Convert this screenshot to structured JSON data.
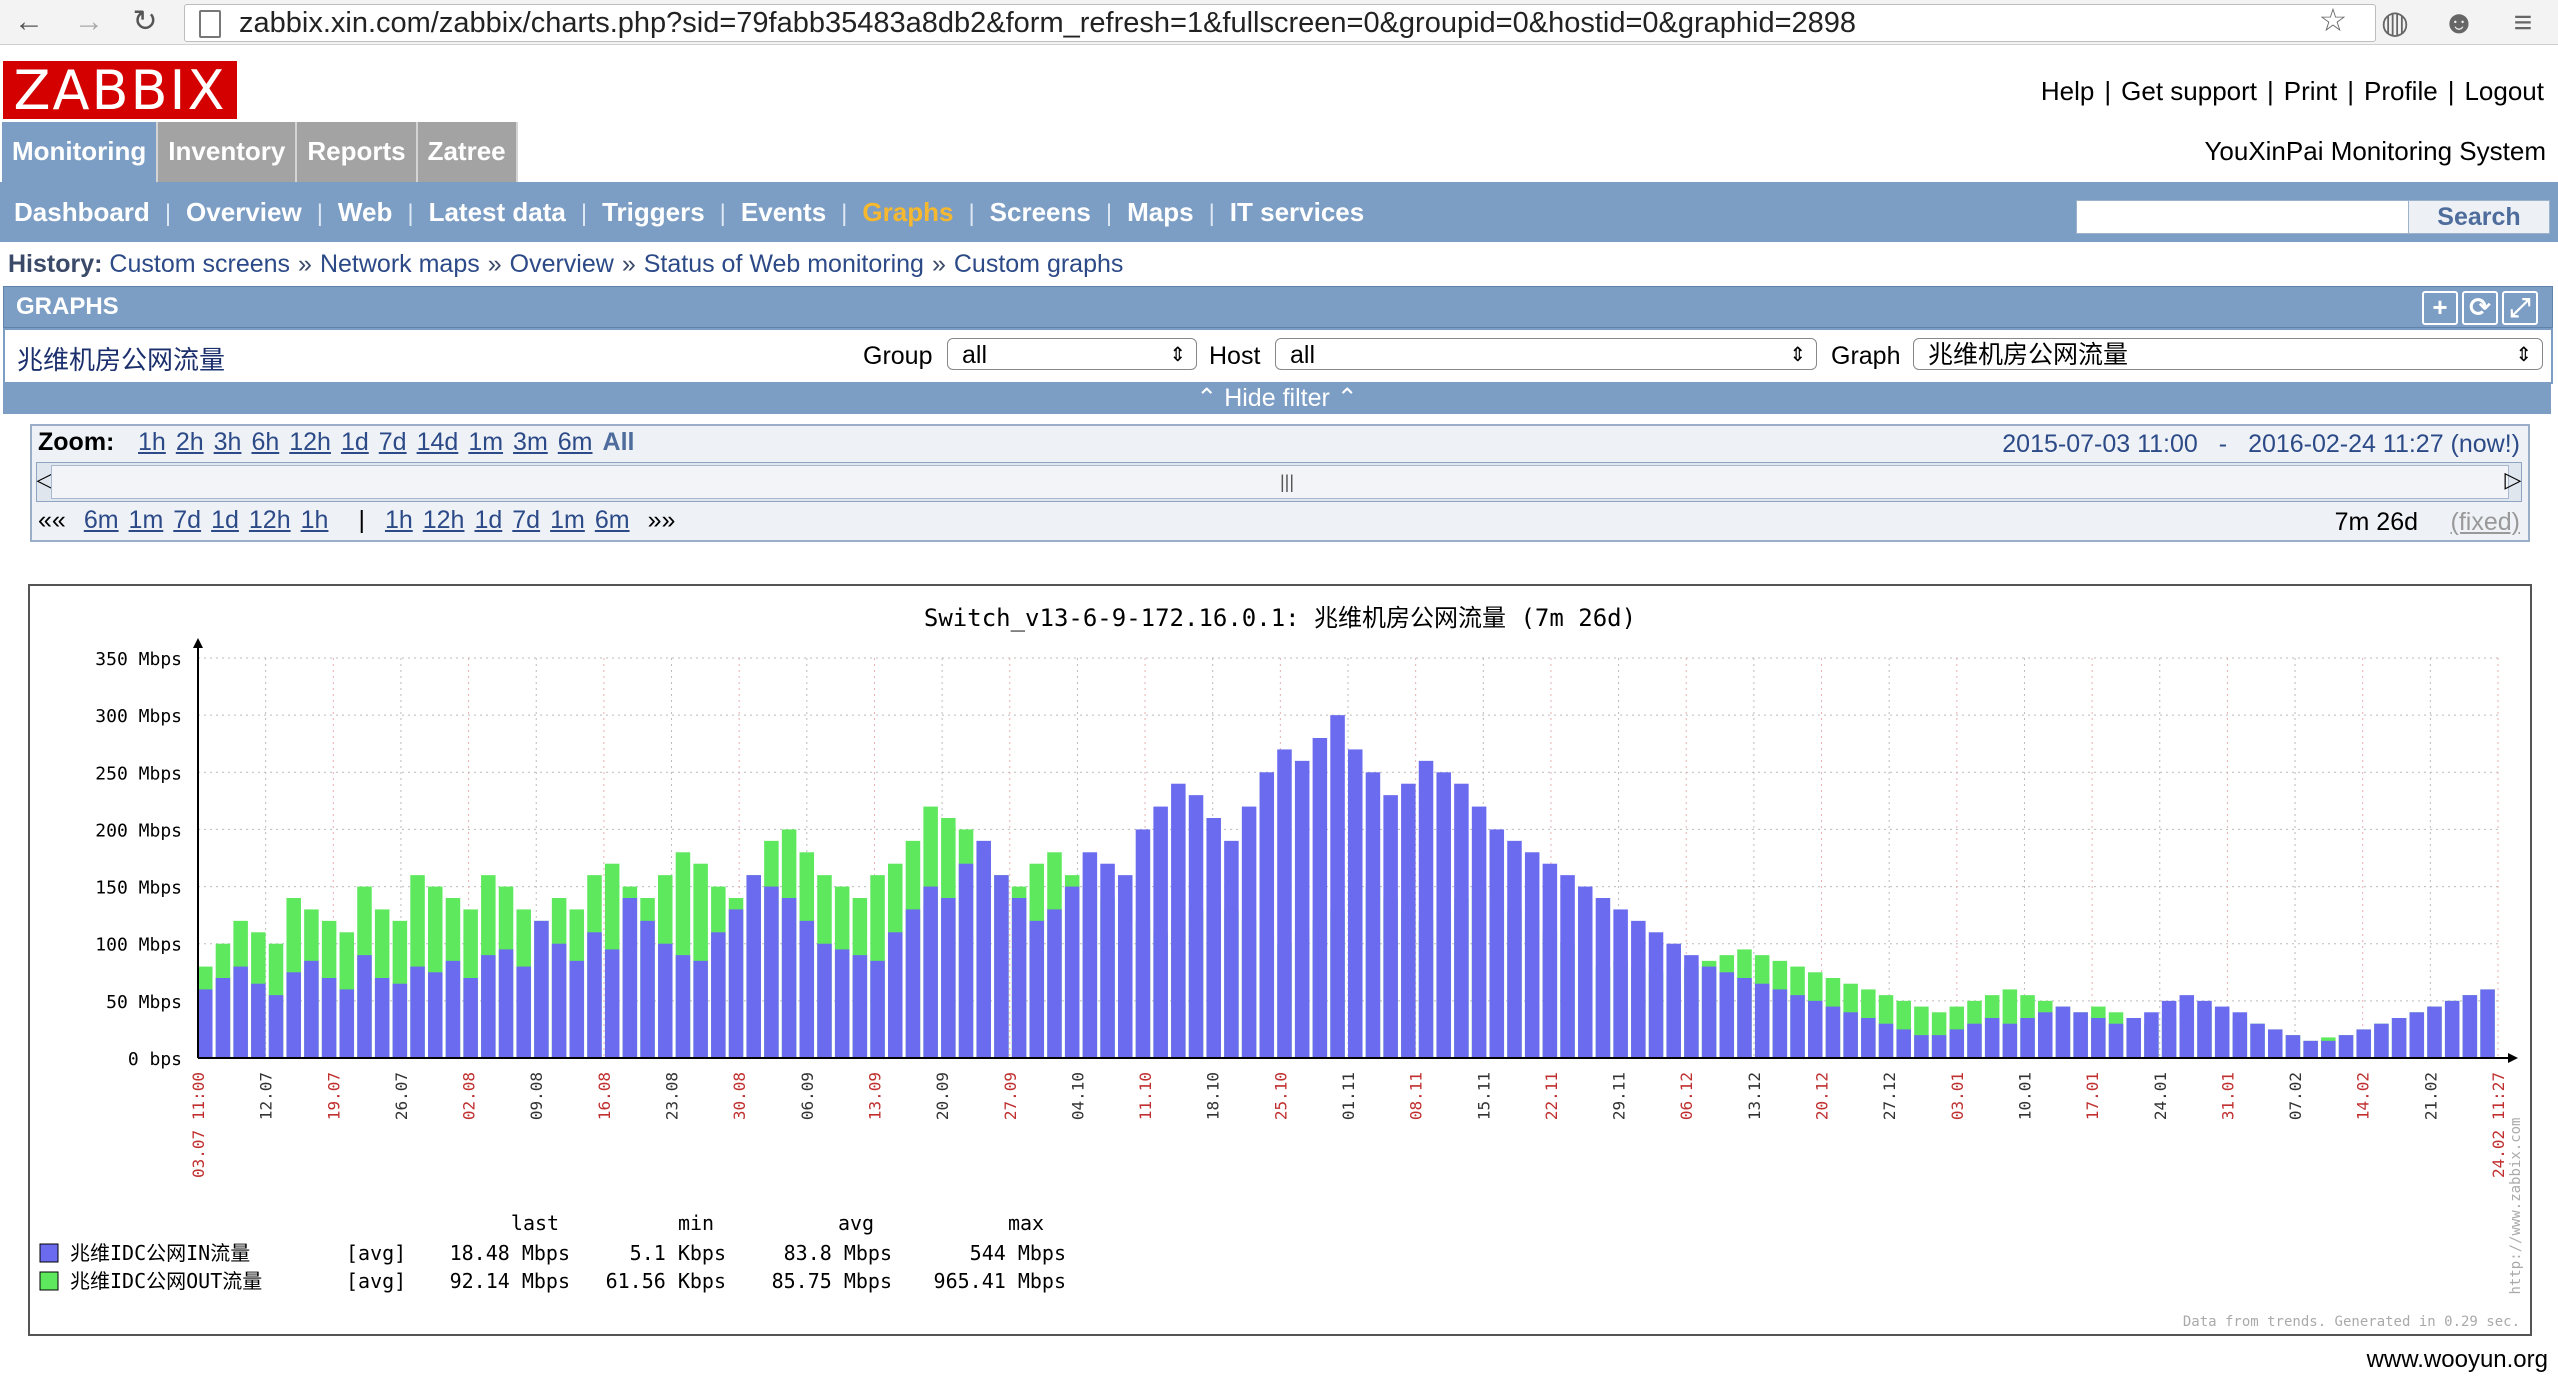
{
  "browser": {
    "url": "zabbix.xin.com/zabbix/charts.php?sid=79fabb35483a8db2&form_refresh=1&fullscreen=0&groupid=0&hostid=0&graphid=2898"
  },
  "header": {
    "logo_text": "ZABBIX",
    "top_links": [
      "Help",
      "Get support",
      "Print",
      "Profile",
      "Logout"
    ],
    "system_name": "YouXinPai Monitoring System"
  },
  "main_nav": {
    "tabs": [
      {
        "label": "Monitoring",
        "active": true
      },
      {
        "label": "Inventory",
        "active": false
      },
      {
        "label": "Reports",
        "active": false
      },
      {
        "label": "Zatree",
        "active": false
      }
    ]
  },
  "sub_nav": {
    "items": [
      {
        "label": "Dashboard",
        "active": false
      },
      {
        "label": "Overview",
        "active": false
      },
      {
        "label": "Web",
        "active": false
      },
      {
        "label": "Latest data",
        "active": false
      },
      {
        "label": "Triggers",
        "active": false
      },
      {
        "label": "Events",
        "active": false
      },
      {
        "label": "Graphs",
        "active": true
      },
      {
        "label": "Screens",
        "active": false
      },
      {
        "label": "Maps",
        "active": false
      },
      {
        "label": "IT services",
        "active": false
      }
    ],
    "search_button": "Search",
    "search_value": ""
  },
  "history": {
    "label": "History:",
    "items": [
      "Custom screens",
      "Network maps",
      "Overview",
      "Status of Web monitoring",
      "Custom graphs"
    ],
    "separator": "»"
  },
  "graphs_panel": {
    "title": "GRAPHS",
    "graph_name": "兆维机房公网流量",
    "filters": {
      "group_label": "Group",
      "group_value": "all",
      "host_label": "Host",
      "host_value": "all",
      "graph_label": "Graph",
      "graph_value": "兆维机房公网流量"
    },
    "hide_filter": "Hide filter"
  },
  "zoom": {
    "label": "Zoom:",
    "options": [
      "1h",
      "2h",
      "3h",
      "6h",
      "12h",
      "1d",
      "7d",
      "14d",
      "1m",
      "3m",
      "6m",
      "All"
    ],
    "selected": "All",
    "period_start": "2015-07-03 11:00",
    "period_sep": "-",
    "period_end": "2016-02-24 11:27 (now!)",
    "back_arrows": "««",
    "back_options": [
      "6m",
      "1m",
      "7d",
      "1d",
      "12h",
      "1h"
    ],
    "forward_options": [
      "1h",
      "12h",
      "1d",
      "7d",
      "1m",
      "6m"
    ],
    "forward_arrows": "»»",
    "divider": "|",
    "duration": "7m 26d",
    "fixed": "(fixed)"
  },
  "chart_data": {
    "type": "area",
    "title": "Switch_v13-6-9-172.16.0.1: 兆维机房公网流量 (7m 26d)",
    "y_unit": "Mbps",
    "y_ticks": [
      "0 bps",
      "50 Mbps",
      "100 Mbps",
      "150 Mbps",
      "200 Mbps",
      "250 Mbps",
      "300 Mbps",
      "350 Mbps"
    ],
    "ylim": [
      0,
      350
    ],
    "x_ticks": [
      {
        "label": "03.07 11:00",
        "red": true
      },
      {
        "label": "12.07",
        "red": false
      },
      {
        "label": "19.07",
        "red": true
      },
      {
        "label": "26.07",
        "red": false
      },
      {
        "label": "02.08",
        "red": true
      },
      {
        "label": "09.08",
        "red": false
      },
      {
        "label": "16.08",
        "red": true
      },
      {
        "label": "23.08",
        "red": false
      },
      {
        "label": "30.08",
        "red": true
      },
      {
        "label": "06.09",
        "red": false
      },
      {
        "label": "13.09",
        "red": true
      },
      {
        "label": "20.09",
        "red": false
      },
      {
        "label": "27.09",
        "red": true
      },
      {
        "label": "04.10",
        "red": false
      },
      {
        "label": "11.10",
        "red": true
      },
      {
        "label": "18.10",
        "red": false
      },
      {
        "label": "25.10",
        "red": true
      },
      {
        "label": "01.11",
        "red": false
      },
      {
        "label": "08.11",
        "red": true
      },
      {
        "label": "15.11",
        "red": false
      },
      {
        "label": "22.11",
        "red": true
      },
      {
        "label": "29.11",
        "red": false
      },
      {
        "label": "06.12",
        "red": true
      },
      {
        "label": "13.12",
        "red": false
      },
      {
        "label": "20.12",
        "red": true
      },
      {
        "label": "27.12",
        "red": false
      },
      {
        "label": "03.01",
        "red": true
      },
      {
        "label": "10.01",
        "red": false
      },
      {
        "label": "17.01",
        "red": true
      },
      {
        "label": "24.01",
        "red": false
      },
      {
        "label": "31.01",
        "red": true
      },
      {
        "label": "07.02",
        "red": false
      },
      {
        "label": "14.02",
        "red": true
      },
      {
        "label": "21.02",
        "red": false
      },
      {
        "label": "24.02 11:27",
        "red": true
      }
    ],
    "series_colors": {
      "in": "#6b6bf0",
      "out": "#5ee85e"
    },
    "series": [
      {
        "name": "兆维IDC公网IN流量",
        "values": [
          60,
          70,
          80,
          65,
          55,
          75,
          85,
          70,
          60,
          90,
          70,
          65,
          80,
          75,
          85,
          70,
          90,
          95,
          80,
          120,
          100,
          85,
          110,
          95,
          140,
          120,
          100,
          90,
          85,
          110,
          130,
          160,
          150,
          140,
          120,
          100,
          95,
          90,
          85,
          110,
          130,
          150,
          140,
          170,
          190,
          160,
          140,
          120,
          130,
          150,
          180,
          170,
          160,
          200,
          220,
          240,
          230,
          210,
          190,
          220,
          250,
          270,
          260,
          280,
          300,
          270,
          250,
          230,
          240,
          260,
          250,
          240,
          220,
          200,
          190,
          180,
          170,
          160,
          150,
          140,
          130,
          120,
          110,
          100,
          90,
          80,
          75,
          70,
          65,
          60,
          55,
          50,
          45,
          40,
          35,
          30,
          25,
          20,
          20,
          25,
          30,
          35,
          30,
          35,
          40,
          45,
          40,
          35,
          30,
          35,
          40,
          50,
          55,
          50,
          45,
          40,
          30,
          25,
          20,
          15,
          15,
          20,
          25,
          30,
          35,
          40,
          45,
          50,
          55,
          60
        ]
      },
      {
        "name": "兆维IDC公网OUT流量",
        "values": [
          80,
          100,
          120,
          110,
          100,
          140,
          130,
          120,
          110,
          150,
          130,
          120,
          160,
          150,
          140,
          130,
          160,
          150,
          130,
          120,
          140,
          130,
          160,
          170,
          150,
          140,
          160,
          180,
          170,
          150,
          140,
          160,
          190,
          200,
          180,
          160,
          150,
          140,
          160,
          170,
          190,
          220,
          210,
          200,
          180,
          160,
          150,
          170,
          180,
          160,
          150,
          140,
          130,
          120,
          110,
          120,
          130,
          140,
          130,
          120,
          110,
          100,
          110,
          120,
          130,
          140,
          150,
          140,
          130,
          120,
          130,
          140,
          150,
          140,
          130,
          120,
          110,
          100,
          90,
          80,
          85,
          80,
          75,
          70,
          80,
          85,
          90,
          95,
          90,
          85,
          80,
          75,
          70,
          65,
          60,
          55,
          50,
          45,
          40,
          45,
          50,
          55,
          60,
          55,
          50,
          45,
          40,
          45,
          40,
          35,
          30,
          35,
          40,
          45,
          40,
          35,
          30,
          25,
          20,
          15,
          18,
          20,
          25,
          30,
          35,
          40,
          45,
          50,
          55,
          60
        ]
      }
    ],
    "legend": {
      "headers": [
        "last",
        "min",
        "avg",
        "max"
      ],
      "rows": [
        {
          "name": "兆维IDC公网IN流量",
          "func": "[avg]",
          "last": "18.48 Mbps",
          "min": "5.1 Kbps",
          "avg": "83.8 Mbps",
          "max": "544 Mbps",
          "color": "#6b6bf0"
        },
        {
          "name": "兆维IDC公网OUT流量",
          "func": "[avg]",
          "last": "92.14 Mbps",
          "min": "61.56 Kbps",
          "avg": "85.75 Mbps",
          "max": "965.41 Mbps",
          "color": "#5ee85e"
        }
      ]
    },
    "side_note": "http://www.zabbix.com",
    "footer_note": "Data from trends. Generated in 0.29 sec."
  },
  "footer": {
    "watermark": "www.wooyun.org"
  }
}
